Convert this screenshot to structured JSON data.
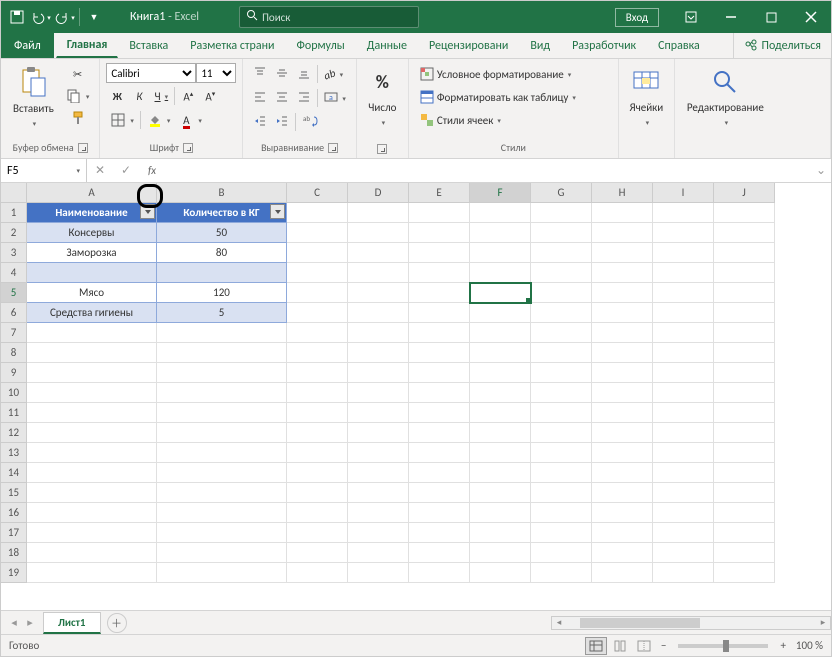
{
  "title": {
    "document": "Книга1",
    "app": "Excel"
  },
  "search": {
    "placeholder": "Поиск"
  },
  "login": "Вход",
  "tabs": {
    "file": "Файл",
    "home": "Главная",
    "insert": "Вставка",
    "layout": "Разметка страни",
    "formulas": "Формулы",
    "data": "Данные",
    "review": "Рецензировани",
    "view": "Вид",
    "developer": "Разработчик",
    "help": "Справка"
  },
  "share": "Поделиться",
  "ribbon": {
    "clipboard": {
      "paste": "Вставить",
      "label": "Буфер обмена"
    },
    "font": {
      "name": "Calibri",
      "size": "11",
      "label": "Шрифт",
      "bold": "Ж",
      "italic": "К",
      "underline": "Ч"
    },
    "align": {
      "label": "Выравнивание"
    },
    "number": {
      "big": "%",
      "label": "Число"
    },
    "styles": {
      "cond": "Условное форматирование",
      "table": "Форматировать как таблицу",
      "cell": "Стили ячеек",
      "label": "Стили"
    },
    "cells": {
      "label": "Ячейки"
    },
    "editing": {
      "label": "Редактирование"
    }
  },
  "namebox": "F5",
  "columns": [
    "A",
    "B",
    "C",
    "D",
    "E",
    "F",
    "G",
    "H",
    "I",
    "J"
  ],
  "rows": [
    "1",
    "2",
    "3",
    "4",
    "5",
    "6",
    "7",
    "8",
    "9",
    "10",
    "11",
    "12",
    "13",
    "14",
    "15",
    "16",
    "17",
    "18",
    "19"
  ],
  "table": {
    "headers": [
      "Наименование",
      "Количество в КГ"
    ],
    "data": [
      {
        "name": "Консервы",
        "qty": "50"
      },
      {
        "name": "Заморозка",
        "qty": "80"
      },
      {
        "name": "",
        "qty": ""
      },
      {
        "name": "Мясо",
        "qty": "120"
      },
      {
        "name": "Средства гигиены",
        "qty": "5"
      }
    ]
  },
  "selected_cell": "F5",
  "sheet": {
    "name": "Лист1"
  },
  "status": {
    "ready": "Готово",
    "zoom": "100 %"
  }
}
